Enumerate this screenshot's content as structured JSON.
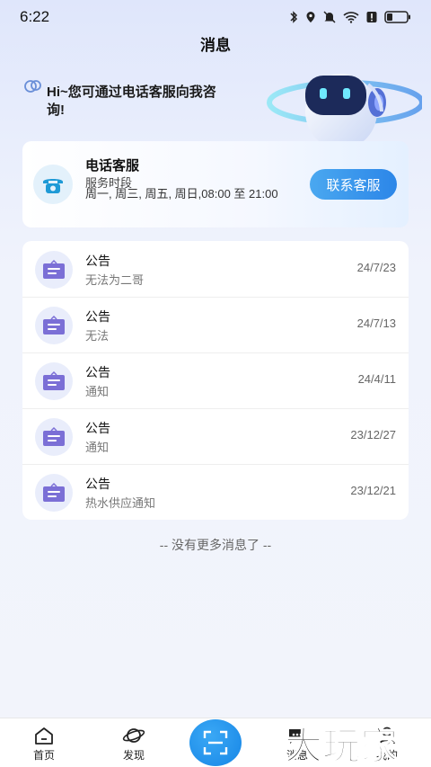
{
  "status_bar": {
    "time": "6:22"
  },
  "header": {
    "title": "消息"
  },
  "hero": {
    "greeting": "Hi~您可通过电话客服向我咨询!"
  },
  "service": {
    "title": "电话客服",
    "subtitle": "服务时段",
    "hours": "周一, 周三, 周五, 周日,08:00 至 21:00",
    "button_label": "联系客服"
  },
  "notices": [
    {
      "title": "公告",
      "summary": "无法为二哥",
      "date": "24/7/23"
    },
    {
      "title": "公告",
      "summary": "无法",
      "date": "24/7/13"
    },
    {
      "title": "公告",
      "summary": "通知",
      "date": "24/4/11"
    },
    {
      "title": "公告",
      "summary": "通知",
      "date": "23/12/27"
    },
    {
      "title": "公告",
      "summary": "热水供应通知",
      "date": "23/12/21"
    }
  ],
  "footer_text": "-- 没有更多消息了 --",
  "tabbar": {
    "home": "首页",
    "discover": "发现",
    "messages": "消息",
    "mine": "我的"
  },
  "watermark": "大玩家",
  "colors": {
    "accent": "#2c86e8",
    "notice_icon": "#7b6fd6",
    "phone_icon": "#1e9ad6"
  }
}
